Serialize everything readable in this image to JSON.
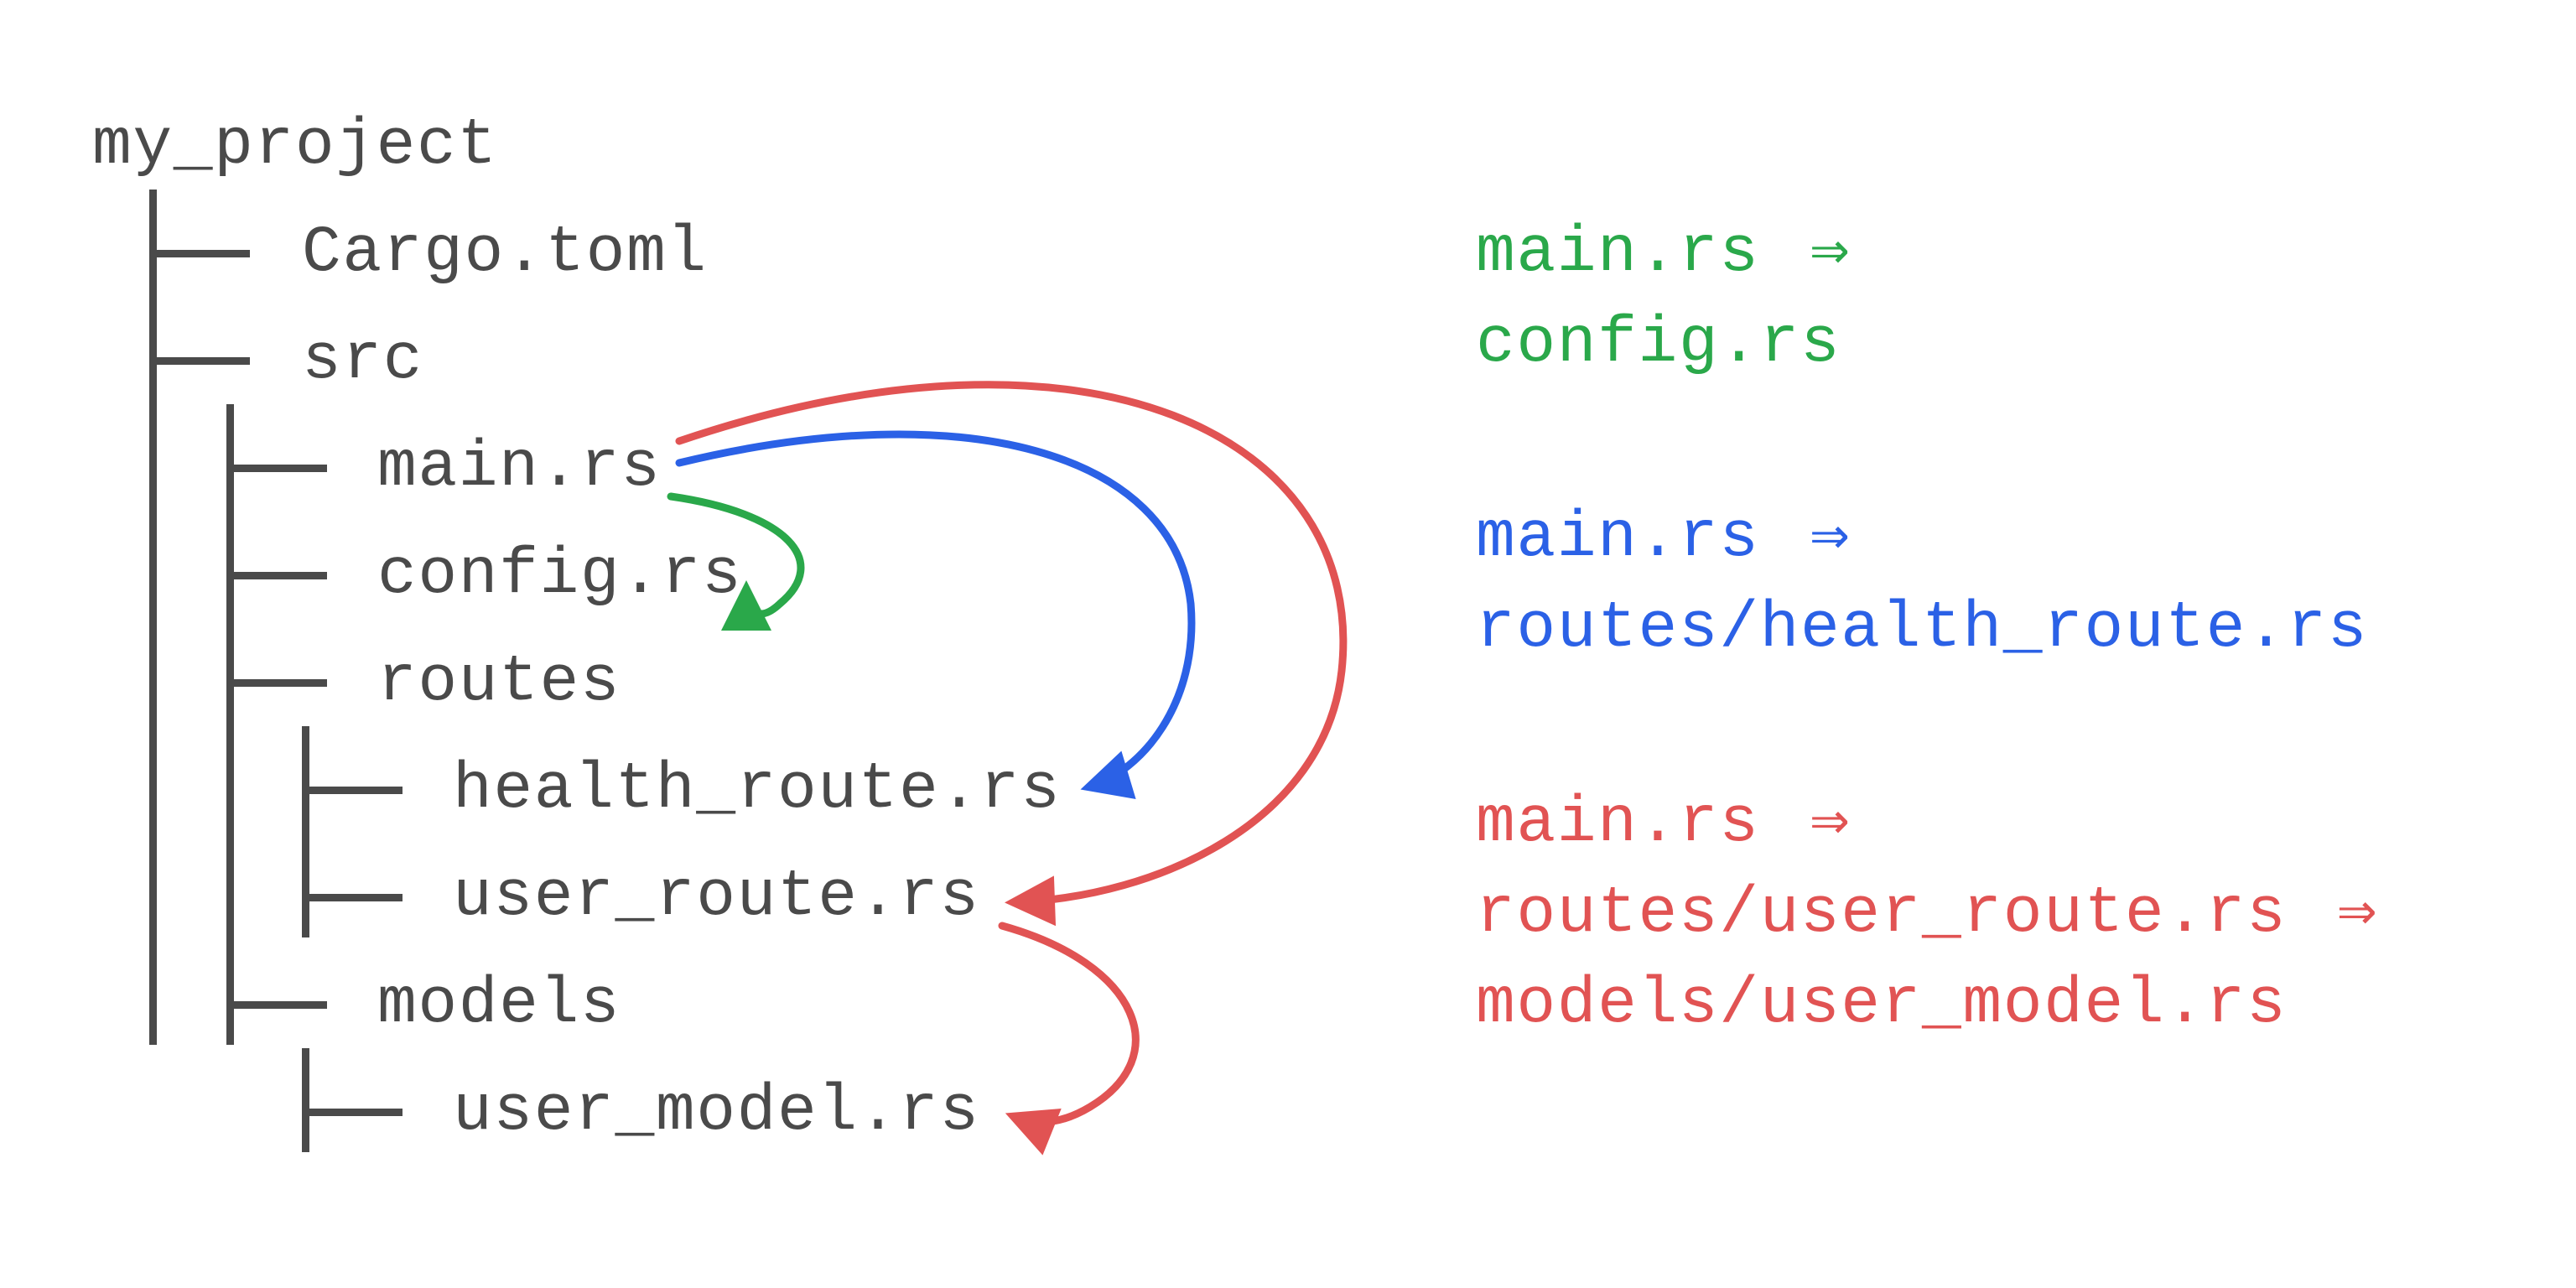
{
  "colors": {
    "text": "#4a4a4a",
    "green": "#2aa84a",
    "blue": "#2b61e6",
    "red": "#e15353"
  },
  "tree": {
    "root": "my_project",
    "cargo": "Cargo.toml",
    "src": "src",
    "main": "main.rs",
    "config": "config.rs",
    "routes": "routes",
    "health_route": "health_route.rs",
    "user_route": "user_route.rs",
    "models": "models",
    "user_model": "user_model.rs"
  },
  "legend": {
    "g1": "main.rs",
    "g2": "config.rs",
    "b1": "main.rs",
    "b2": "routes/health_route.rs",
    "r1": "main.rs",
    "r2": "routes/user_route.rs",
    "r3": "models/user_model.rs",
    "arrow": "⇒"
  },
  "dependencies": [
    {
      "from": "main.rs",
      "to": "config.rs",
      "color": "green"
    },
    {
      "from": "main.rs",
      "to": "routes/health_route.rs",
      "color": "blue"
    },
    {
      "from": "main.rs",
      "to": "routes/user_route.rs",
      "color": "red"
    },
    {
      "from": "routes/user_route.rs",
      "to": "models/user_model.rs",
      "color": "red"
    }
  ]
}
